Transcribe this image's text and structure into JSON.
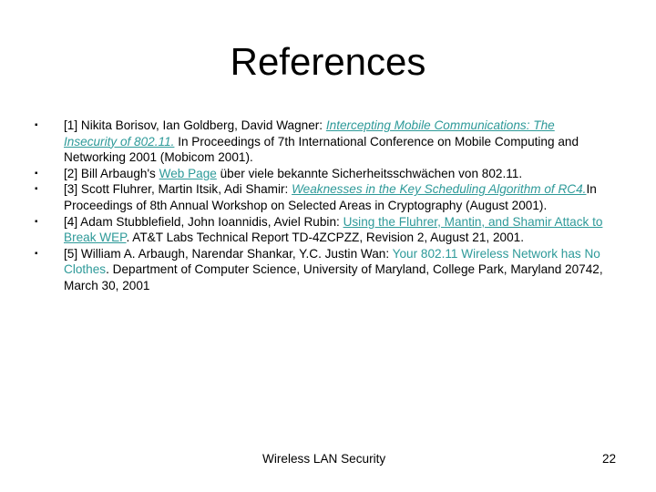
{
  "slide": {
    "title": "References",
    "footer_text": "Wireless LAN Security",
    "page_number": "22",
    "link_color": "#2e9a99"
  },
  "references": [
    {
      "prefix": "[1]  Nikita Borisov, Ian Goldberg, David Wagner: ",
      "link": "Intercepting Mobile Communications: The Insecurity of 802.11.",
      "suffix": " In Proceedings of 7th International Conference on Mobile Computing and Networking 2001 (Mobicom 2001)."
    },
    {
      "prefix": "[2] Bill Arbaugh's ",
      "link": "Web Page",
      "suffix": " über viele bekannte Sicherheitsschwächen von 802.11."
    },
    {
      "prefix": "[3]  Scott Fluhrer, Martin Itsik, Adi Shamir: ",
      "link": "Weaknesses in the Key Scheduling Algorithm of RC4.",
      "suffix": "In Proceedings of 8th Annual Workshop on Selected Areas in Cryptography (August 2001)."
    },
    {
      "prefix": "[4] Adam Stubblefield, John Ioannidis, Aviel Rubin: ",
      "link": "Using the Fluhrer, Mantin, and Shamir Attack to Break WEP",
      "suffix": ". AT&T Labs Technical Report TD-4ZCPZZ, Revision 2, August 21, 2001."
    },
    {
      "prefix": "[5] William A. Arbaugh, Narendar Shankar, Y.C. Justin Wan: ",
      "link": "Your 802.11 Wireless Network has No Clothes",
      "suffix": ". Department of Computer Science, University of Maryland, College Park, Maryland 20742, March 30, 2001"
    }
  ],
  "bullet_glyph": "▪"
}
